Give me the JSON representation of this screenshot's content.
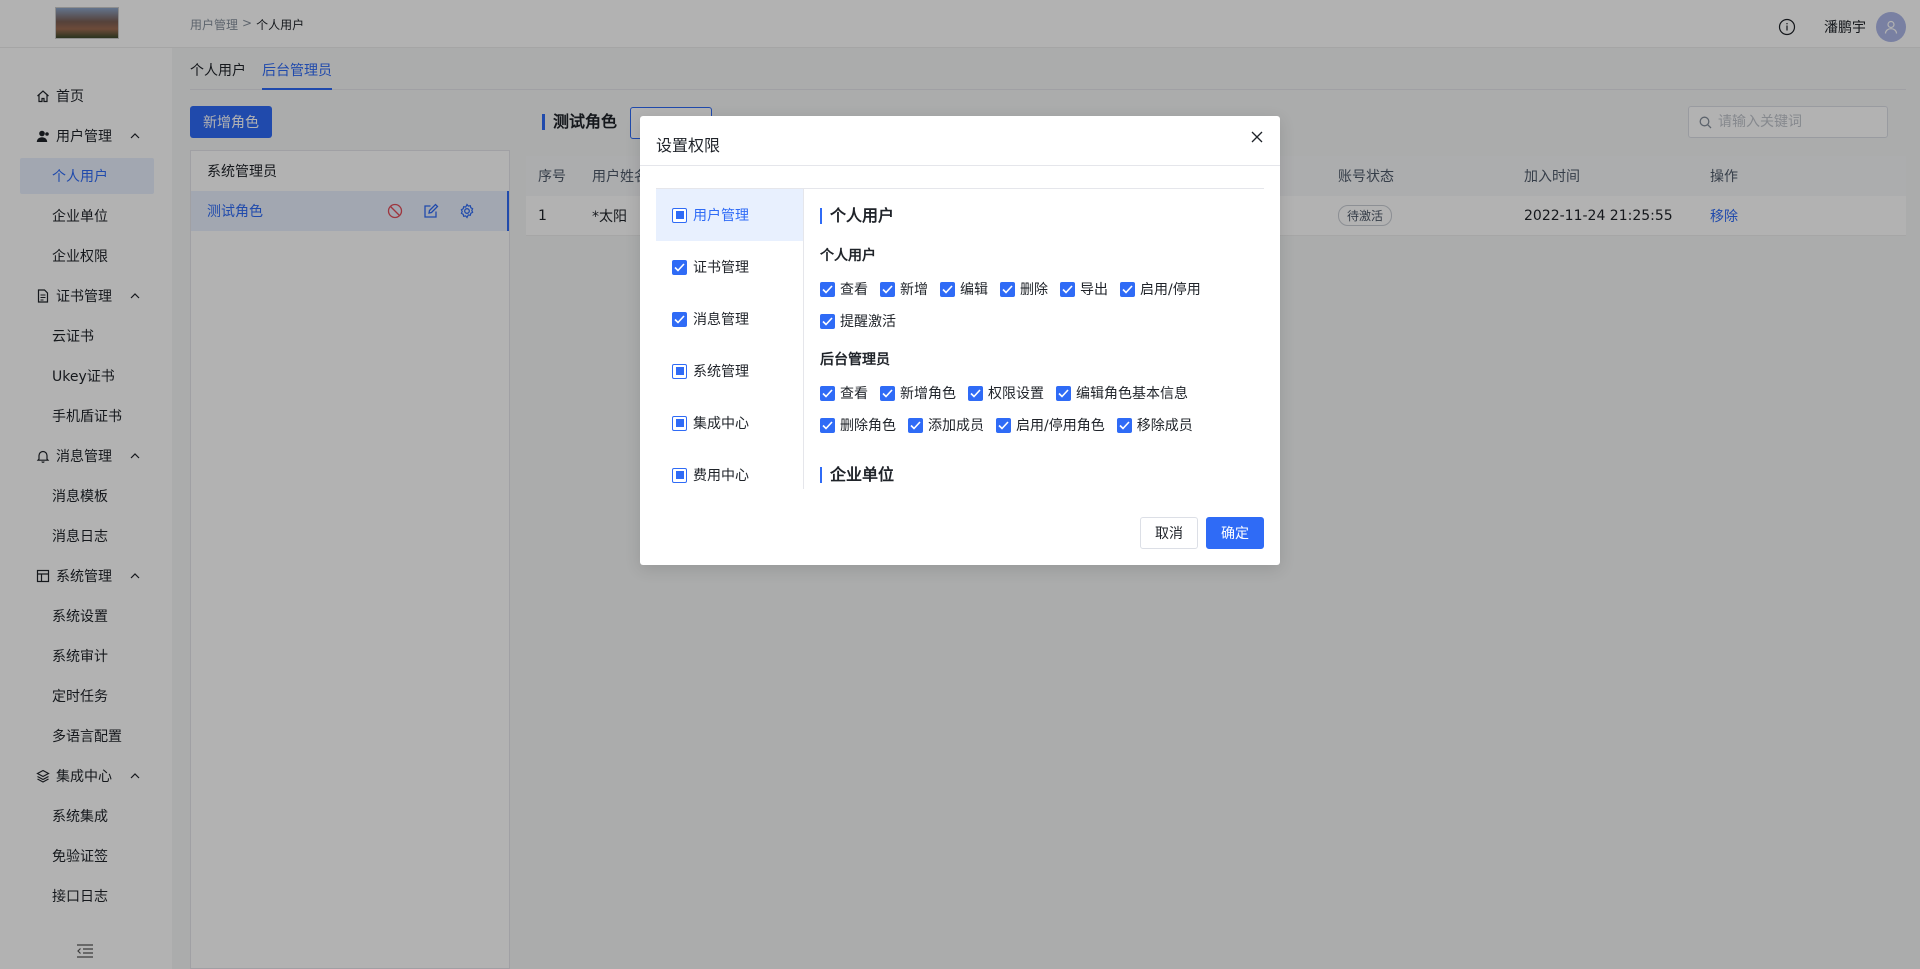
{
  "header": {
    "breadcrumb": [
      "用户管理",
      ">",
      "个人用户"
    ],
    "user_name": "潘鹏宇"
  },
  "sidebar": {
    "groups": [
      {
        "label": "首页",
        "icon": "home-icon",
        "children": []
      },
      {
        "label": "用户管理",
        "icon": "user-icon",
        "children": [
          "个人用户",
          "企业单位",
          "企业权限"
        ]
      },
      {
        "label": "证书管理",
        "icon": "document-icon",
        "children": [
          "云证书",
          "Ukey证书",
          "手机盾证书"
        ]
      },
      {
        "label": "消息管理",
        "icon": "bell-icon",
        "children": [
          "消息模板",
          "消息日志"
        ]
      },
      {
        "label": "系统管理",
        "icon": "layout-icon",
        "children": [
          "系统设置",
          "系统审计",
          "定时任务",
          "多语言配置"
        ]
      },
      {
        "label": "集成中心",
        "icon": "layers-icon",
        "children": [
          "系统集成",
          "免验证签",
          "接口日志"
        ]
      }
    ],
    "active": "个人用户"
  },
  "tabs": [
    {
      "label": "个人用户",
      "active": false
    },
    {
      "label": "后台管理员",
      "active": true
    }
  ],
  "role_panel": {
    "add_button": "新增角色",
    "roles": [
      {
        "label": "系统管理员",
        "active": false
      },
      {
        "label": "测试角色",
        "active": true
      }
    ]
  },
  "main": {
    "role_title": "测试角色",
    "search_placeholder": "请输入关键词",
    "columns": [
      "序号",
      "用户姓名",
      "账号状态",
      "加入时间",
      "操作"
    ],
    "rows": [
      {
        "index": "1",
        "name": "*太阳",
        "status": "待激活",
        "joined": "2022-11-24 21:25:55",
        "action": "移除"
      }
    ]
  },
  "modal": {
    "title": "设置权限",
    "categories": [
      {
        "label": "用户管理",
        "state": "indeterminate",
        "active": true
      },
      {
        "label": "证书管理",
        "state": "checked",
        "active": false
      },
      {
        "label": "消息管理",
        "state": "checked",
        "active": false
      },
      {
        "label": "系统管理",
        "state": "indeterminate",
        "active": false
      },
      {
        "label": "集成中心",
        "state": "indeterminate",
        "active": false
      },
      {
        "label": "费用中心",
        "state": "indeterminate",
        "active": false
      }
    ],
    "section1_title": "个人用户",
    "group1_title": "个人用户",
    "group1_row1": [
      "查看",
      "新增",
      "编辑",
      "删除",
      "导出",
      "启用/停用"
    ],
    "group1_row2": [
      "提醒激活"
    ],
    "group2_title": "后台管理员",
    "group2_row1": [
      "查看",
      "新增角色",
      "权限设置",
      "编辑角色基本信息"
    ],
    "group2_row2": [
      "删除角色",
      "添加成员",
      "启用/停用角色",
      "移除成员"
    ],
    "section2_title": "企业单位",
    "cancel": "取消",
    "confirm": "确定"
  },
  "colors": {
    "primary": "#2f6bf6",
    "overlay": "rgba(0,0,0,0.30)"
  }
}
